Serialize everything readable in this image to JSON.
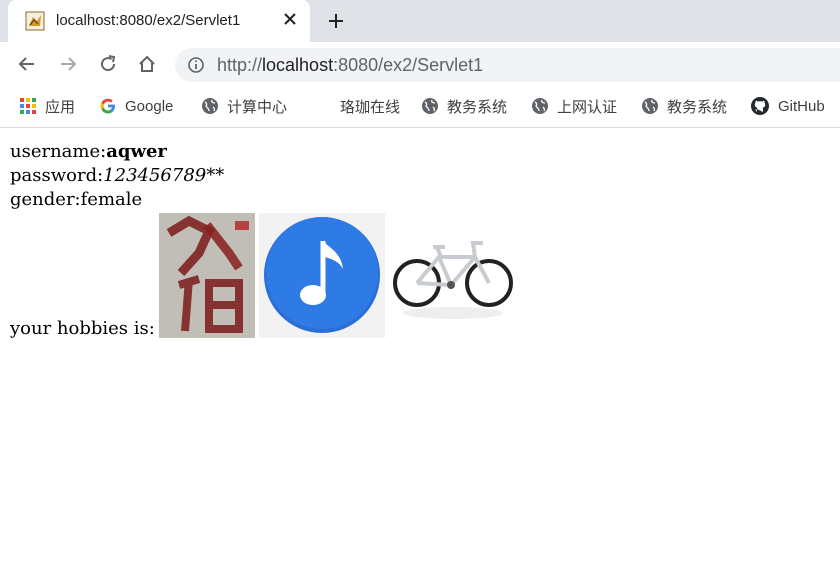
{
  "browser": {
    "tab_title": "localhost:8080/ex2/Servlet1",
    "url_scheme": "http://",
    "url_host": "localhost",
    "url_rest": ":8080/ex2/Servlet1",
    "bookmarks": [
      {
        "label": "应用",
        "icon": "apps-grid-icon"
      },
      {
        "label": "Google",
        "icon": "google-icon"
      },
      {
        "label": "计算中心",
        "icon": "globe-icon"
      },
      {
        "label": "珞珈在线",
        "icon": "none"
      },
      {
        "label": "教务系统",
        "icon": "globe-icon"
      },
      {
        "label": "上网认证",
        "icon": "globe-icon"
      },
      {
        "label": "教务系统",
        "icon": "globe-icon"
      },
      {
        "label": "GitHub",
        "icon": "github-icon"
      }
    ]
  },
  "page": {
    "username_label": "username:",
    "username_value": "aqwer",
    "password_label": "password:",
    "password_value": "123456789",
    "password_suffix": "**",
    "gender_label": "gender:",
    "gender_value": "female",
    "hobbies_label": "your hobbies is:",
    "hobby_images": [
      "calligraphy-image",
      "music-note-image",
      "bicycle-image"
    ]
  },
  "colors": {
    "tabstrip_bg": "#dee1e6",
    "omnibox_bg": "#f1f3f4",
    "music_blue": "#2f7be5"
  }
}
